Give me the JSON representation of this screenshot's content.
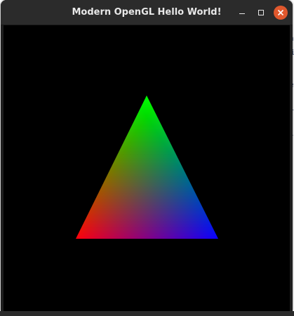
{
  "window": {
    "title": "Modern OpenGL Hello World!"
  },
  "controls": {
    "minimize_icon": "minimize-icon",
    "maximize_icon": "maximize-icon",
    "close_icon": "close-icon"
  },
  "scene": {
    "background": "#000000",
    "triangle": {
      "vertex_colors": {
        "top": "#00ff00",
        "bottom_left": "#ff0000",
        "bottom_right": "#0000ff"
      }
    }
  },
  "colors": {
    "titlebar": "#2b2b2b",
    "close_button": "#e0582d",
    "title_text": "#e8e8e8"
  }
}
